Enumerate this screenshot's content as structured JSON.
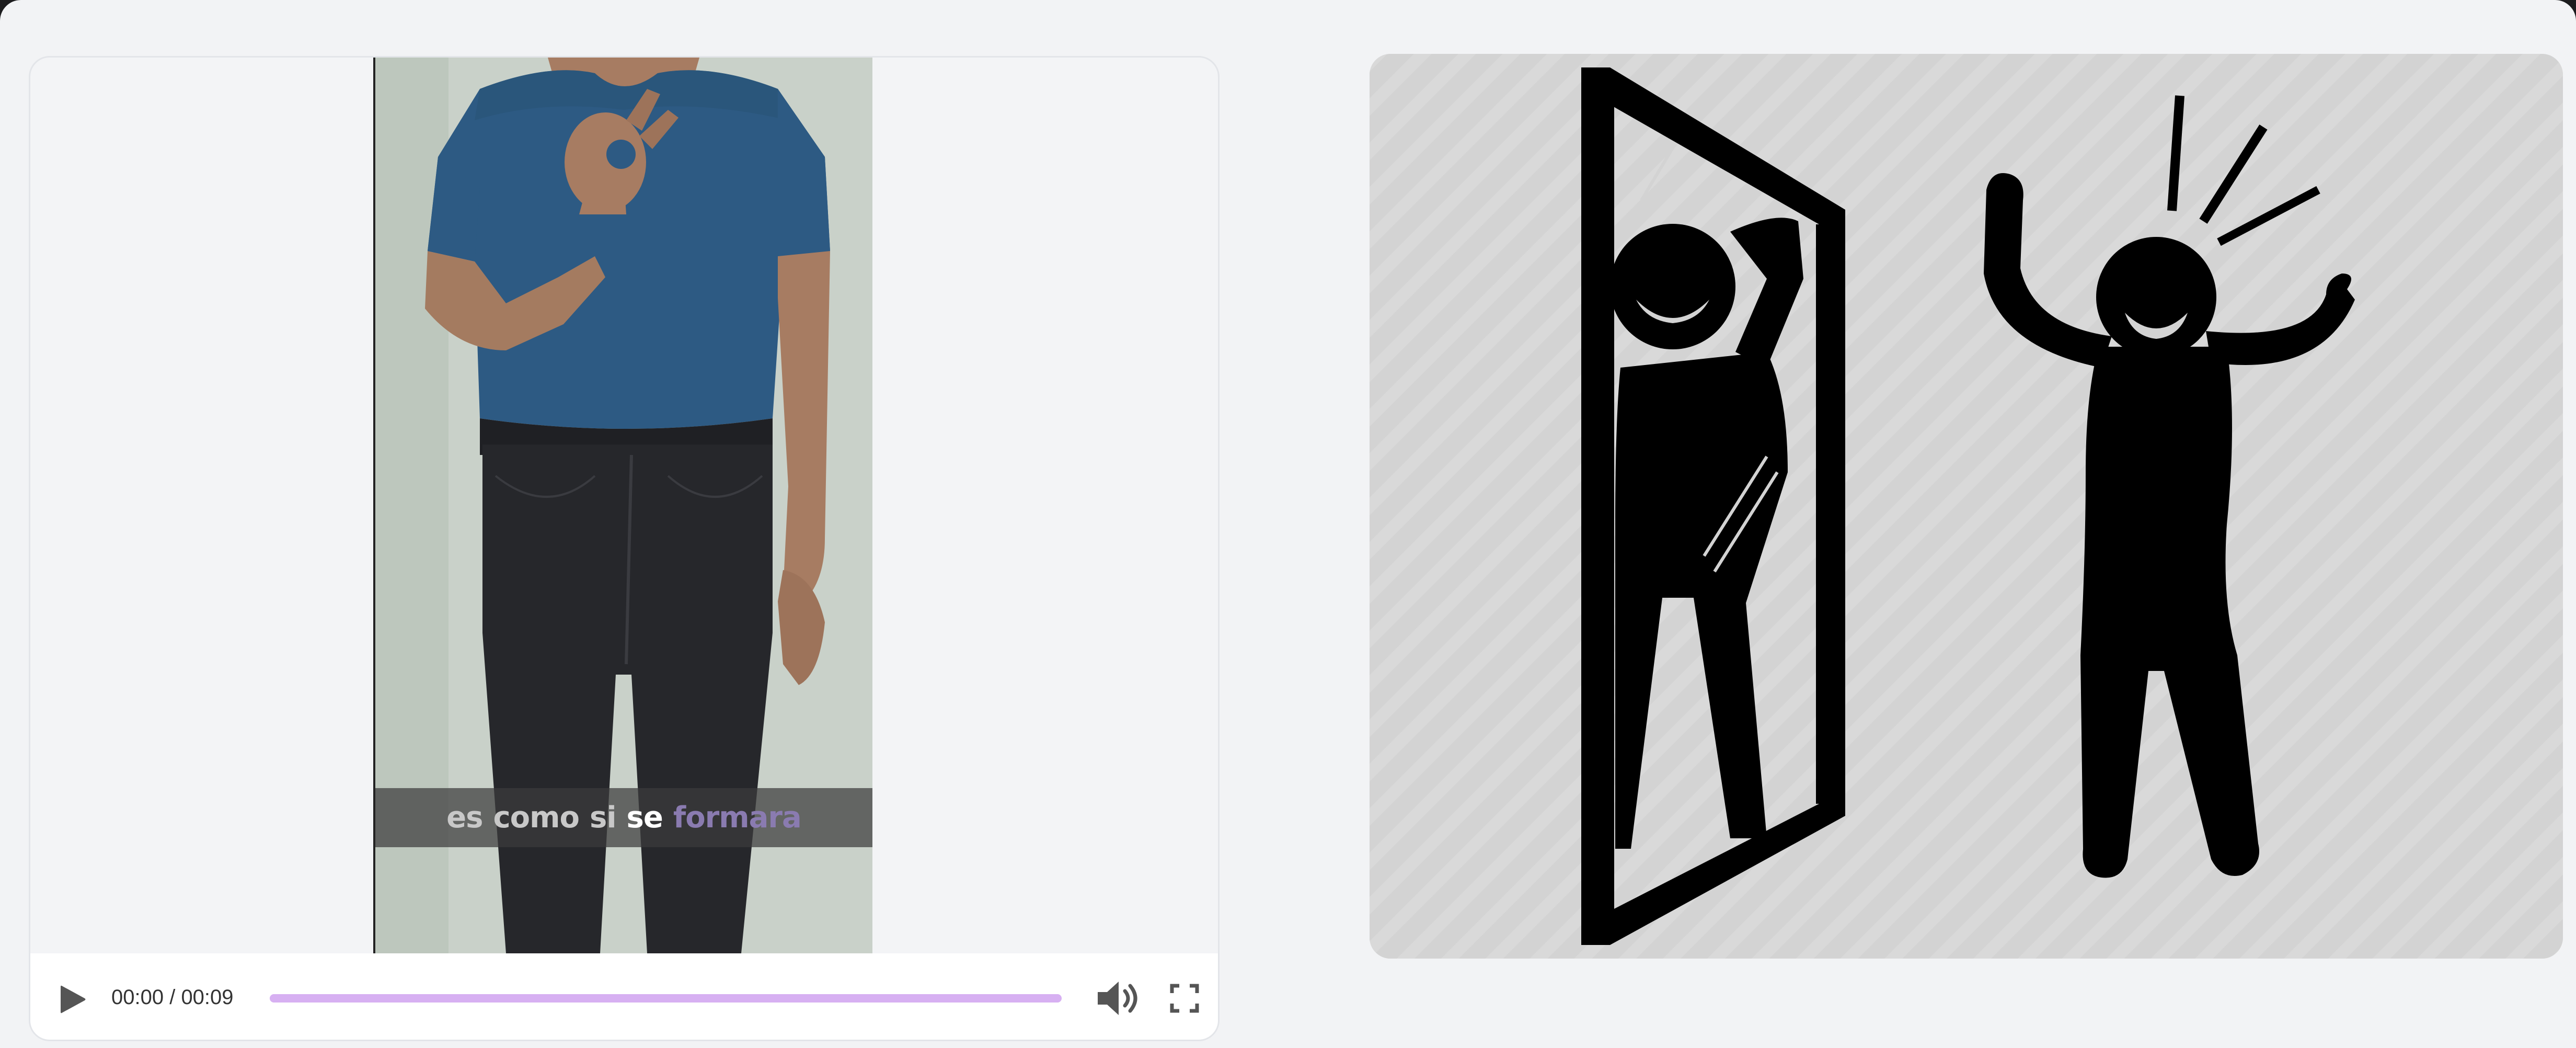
{
  "video": {
    "subtitle_words": [
      {
        "text": "es",
        "state": "spoken"
      },
      {
        "text": "como",
        "state": "spoken"
      },
      {
        "text": "si",
        "state": "spoken"
      },
      {
        "text": "se",
        "state": "current"
      },
      {
        "text": "formara",
        "state": "upcoming"
      }
    ],
    "controls": {
      "play_icon": "play-icon",
      "time_display": "00:00 / 00:09",
      "progress": 0.0,
      "volume_icon": "volume-icon",
      "fullscreen_icon": "fullscreen-icon",
      "seek_color": "#d7b0f2"
    }
  },
  "illustration": {
    "description_icon": "mirror-reflection-celebration-icon",
    "background_color": "#d3d3d3"
  }
}
